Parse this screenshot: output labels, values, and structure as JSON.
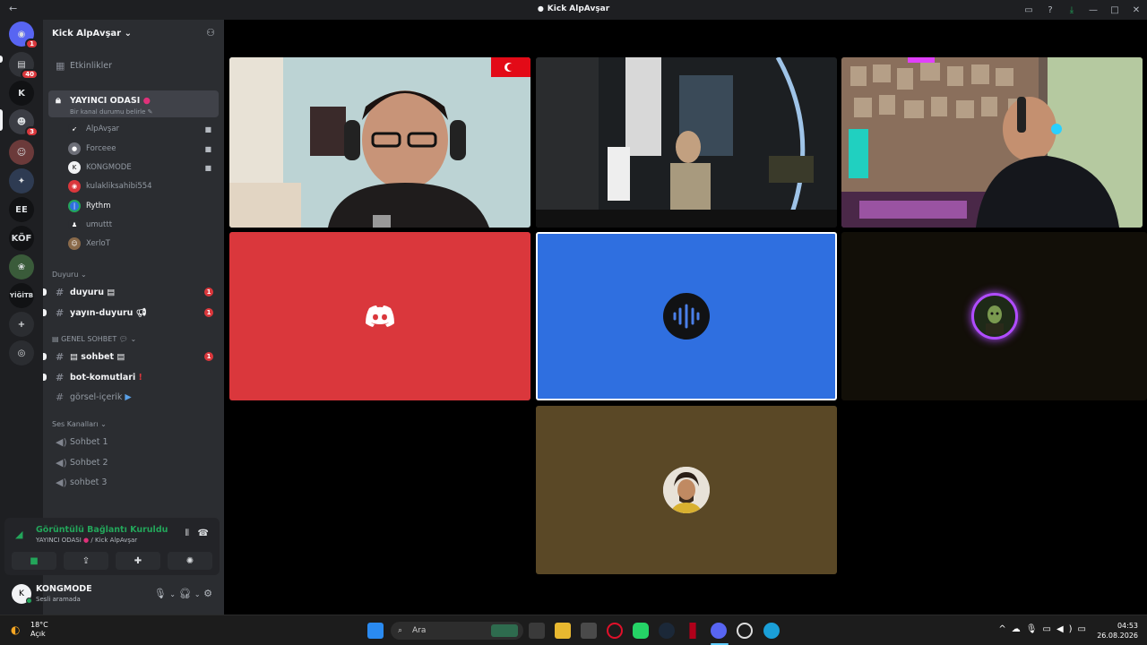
{
  "window": {
    "title": "Kick AlpAvşar"
  },
  "servers": [
    {
      "label": "",
      "badge": "1"
    },
    {
      "label": "",
      "badge": "40"
    },
    {
      "label": "K",
      "badge": ""
    },
    {
      "label": "",
      "badge": "3"
    },
    {
      "label": "",
      "badge": ""
    },
    {
      "label": "",
      "badge": ""
    },
    {
      "label": "EE",
      "badge": ""
    },
    {
      "label": "KÖF",
      "badge": ""
    },
    {
      "label": "",
      "badge": ""
    },
    {
      "label": "YİĞİTB",
      "badge": ""
    }
  ],
  "guild": {
    "name": "Kick AlpAvşar",
    "events_label": "Etkinlikler"
  },
  "voice_channel": {
    "name": "YAYINCI ODASI",
    "status_hint": "Bir kanal durumu belirle"
  },
  "voice_members": [
    {
      "name": "AlpAvşar"
    },
    {
      "name": "Forceee"
    },
    {
      "name": "KONGMODE"
    },
    {
      "name": "kulakliksahibi554"
    },
    {
      "name": "Rythm"
    },
    {
      "name": "umuttt"
    },
    {
      "name": "XerloT"
    }
  ],
  "categories": {
    "duyuru": "Duyuru",
    "genel": "GENEL SOHBET",
    "ses": "Ses Kanalları"
  },
  "text_channels_duyuru": [
    {
      "name": "duyuru",
      "badge": "1"
    },
    {
      "name": "yayın-duyuru",
      "badge": "1"
    }
  ],
  "text_channels_genel": [
    {
      "name": "sohbet",
      "badge": "1"
    },
    {
      "name": "bot-komutlari",
      "badge": ""
    },
    {
      "name": "görsel-içerik",
      "badge": ""
    }
  ],
  "voice_channels": [
    {
      "name": "Sohbet 1"
    },
    {
      "name": "Sohbet 2"
    },
    {
      "name": "sohbet 3"
    }
  ],
  "voice_panel": {
    "status": "Görüntülü Bağlantı Kuruldu",
    "channel": "YAYINCI ODASI",
    "server": "/ Kick AlpAvşar"
  },
  "user_panel": {
    "name": "KONGMODE",
    "status": "Sesli aramada"
  },
  "taskbar": {
    "temperature": "18°C",
    "weather": "Açık",
    "search_placeholder": "Ara",
    "time": "04:53",
    "date": "26.08.2026"
  },
  "colors": {
    "discord_tile": "#da373c",
    "rythm_tile": "#2f6fe0",
    "dark_tile": "#120f08",
    "brown_tile": "#5a4826",
    "accent_green": "#23a55a"
  }
}
